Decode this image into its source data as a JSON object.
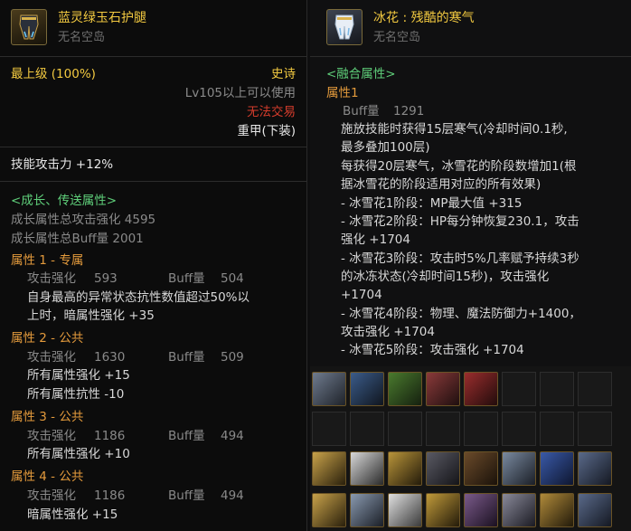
{
  "left": {
    "name": "蓝灵绿玉石护腿",
    "owner": "无名空岛",
    "grade": "最上级 (100%)",
    "rarity": "史诗",
    "level_req": "Lv105以上可以使用",
    "trade": "无法交易",
    "slot_type": "重甲(下装)",
    "skill_atk": "技能攻击力 +12%",
    "growth_header": "<成长、传送属性>",
    "growth_atk": "成长属性总攻击强化 4595",
    "growth_buff": "成长属性总Buff量 2001",
    "attrs": [
      {
        "title": "属性 1 - 专属",
        "atk_label": "攻击强化",
        "atk": "593",
        "buff_label": "Buff量",
        "buff": "504",
        "lines": [
          "自身最高的异常状态抗性数值超过50%以",
          "上时，暗属性强化 +35"
        ]
      },
      {
        "title": "属性 2 - 公共",
        "atk_label": "攻击强化",
        "atk": "1630",
        "buff_label": "Buff量",
        "buff": "509",
        "lines": [
          "所有属性强化 +15",
          "所有属性抗性 -10"
        ]
      },
      {
        "title": "属性 3 - 公共",
        "atk_label": "攻击强化",
        "atk": "1186",
        "buff_label": "Buff量",
        "buff": "494",
        "lines": [
          "所有属性强化 +10"
        ]
      },
      {
        "title": "属性 4 - 公共",
        "atk_label": "攻击强化",
        "atk": "1186",
        "buff_label": "Buff量",
        "buff": "494",
        "lines": [
          "暗属性强化 +15"
        ]
      }
    ]
  },
  "right": {
    "name": "冰花 : 残酷的寒气",
    "owner": "无名空岛",
    "fusion_header": "<融合属性>",
    "attr_title": "属性1",
    "buff_label": "Buff量",
    "buff": "1291",
    "lines": [
      "施放技能时获得15层寒气(冷却时间0.1秒,",
      "最多叠加100层)",
      "每获得20层寒气，冰雪花的阶段数增加1(根",
      "据冰雪花的阶段适用对应的所有效果)",
      "- 冰雪花1阶段：MP最大值 +315",
      "- 冰雪花2阶段：HP每分钟恢复230.1，攻击",
      "强化 +1704",
      "- 冰雪花3阶段：攻击时5%几率赋予持续3秒",
      "的冰冻状态(冷却时间15秒)，攻击强化",
      "+1704",
      "- 冰雪花4阶段：物理、魔法防御力+1400，",
      "攻击强化 +1704",
      "- 冰雪花5阶段：攻击强化 +1704"
    ]
  },
  "colors": {
    "gold": "#f2c940",
    "green": "#5fcf7a",
    "red": "#d43c2c",
    "orange": "#e39a3c",
    "gray": "#8a8a8a"
  },
  "icons": [
    "greaves-icon",
    "ice-greaves-icon",
    "inventory-item-icon"
  ]
}
